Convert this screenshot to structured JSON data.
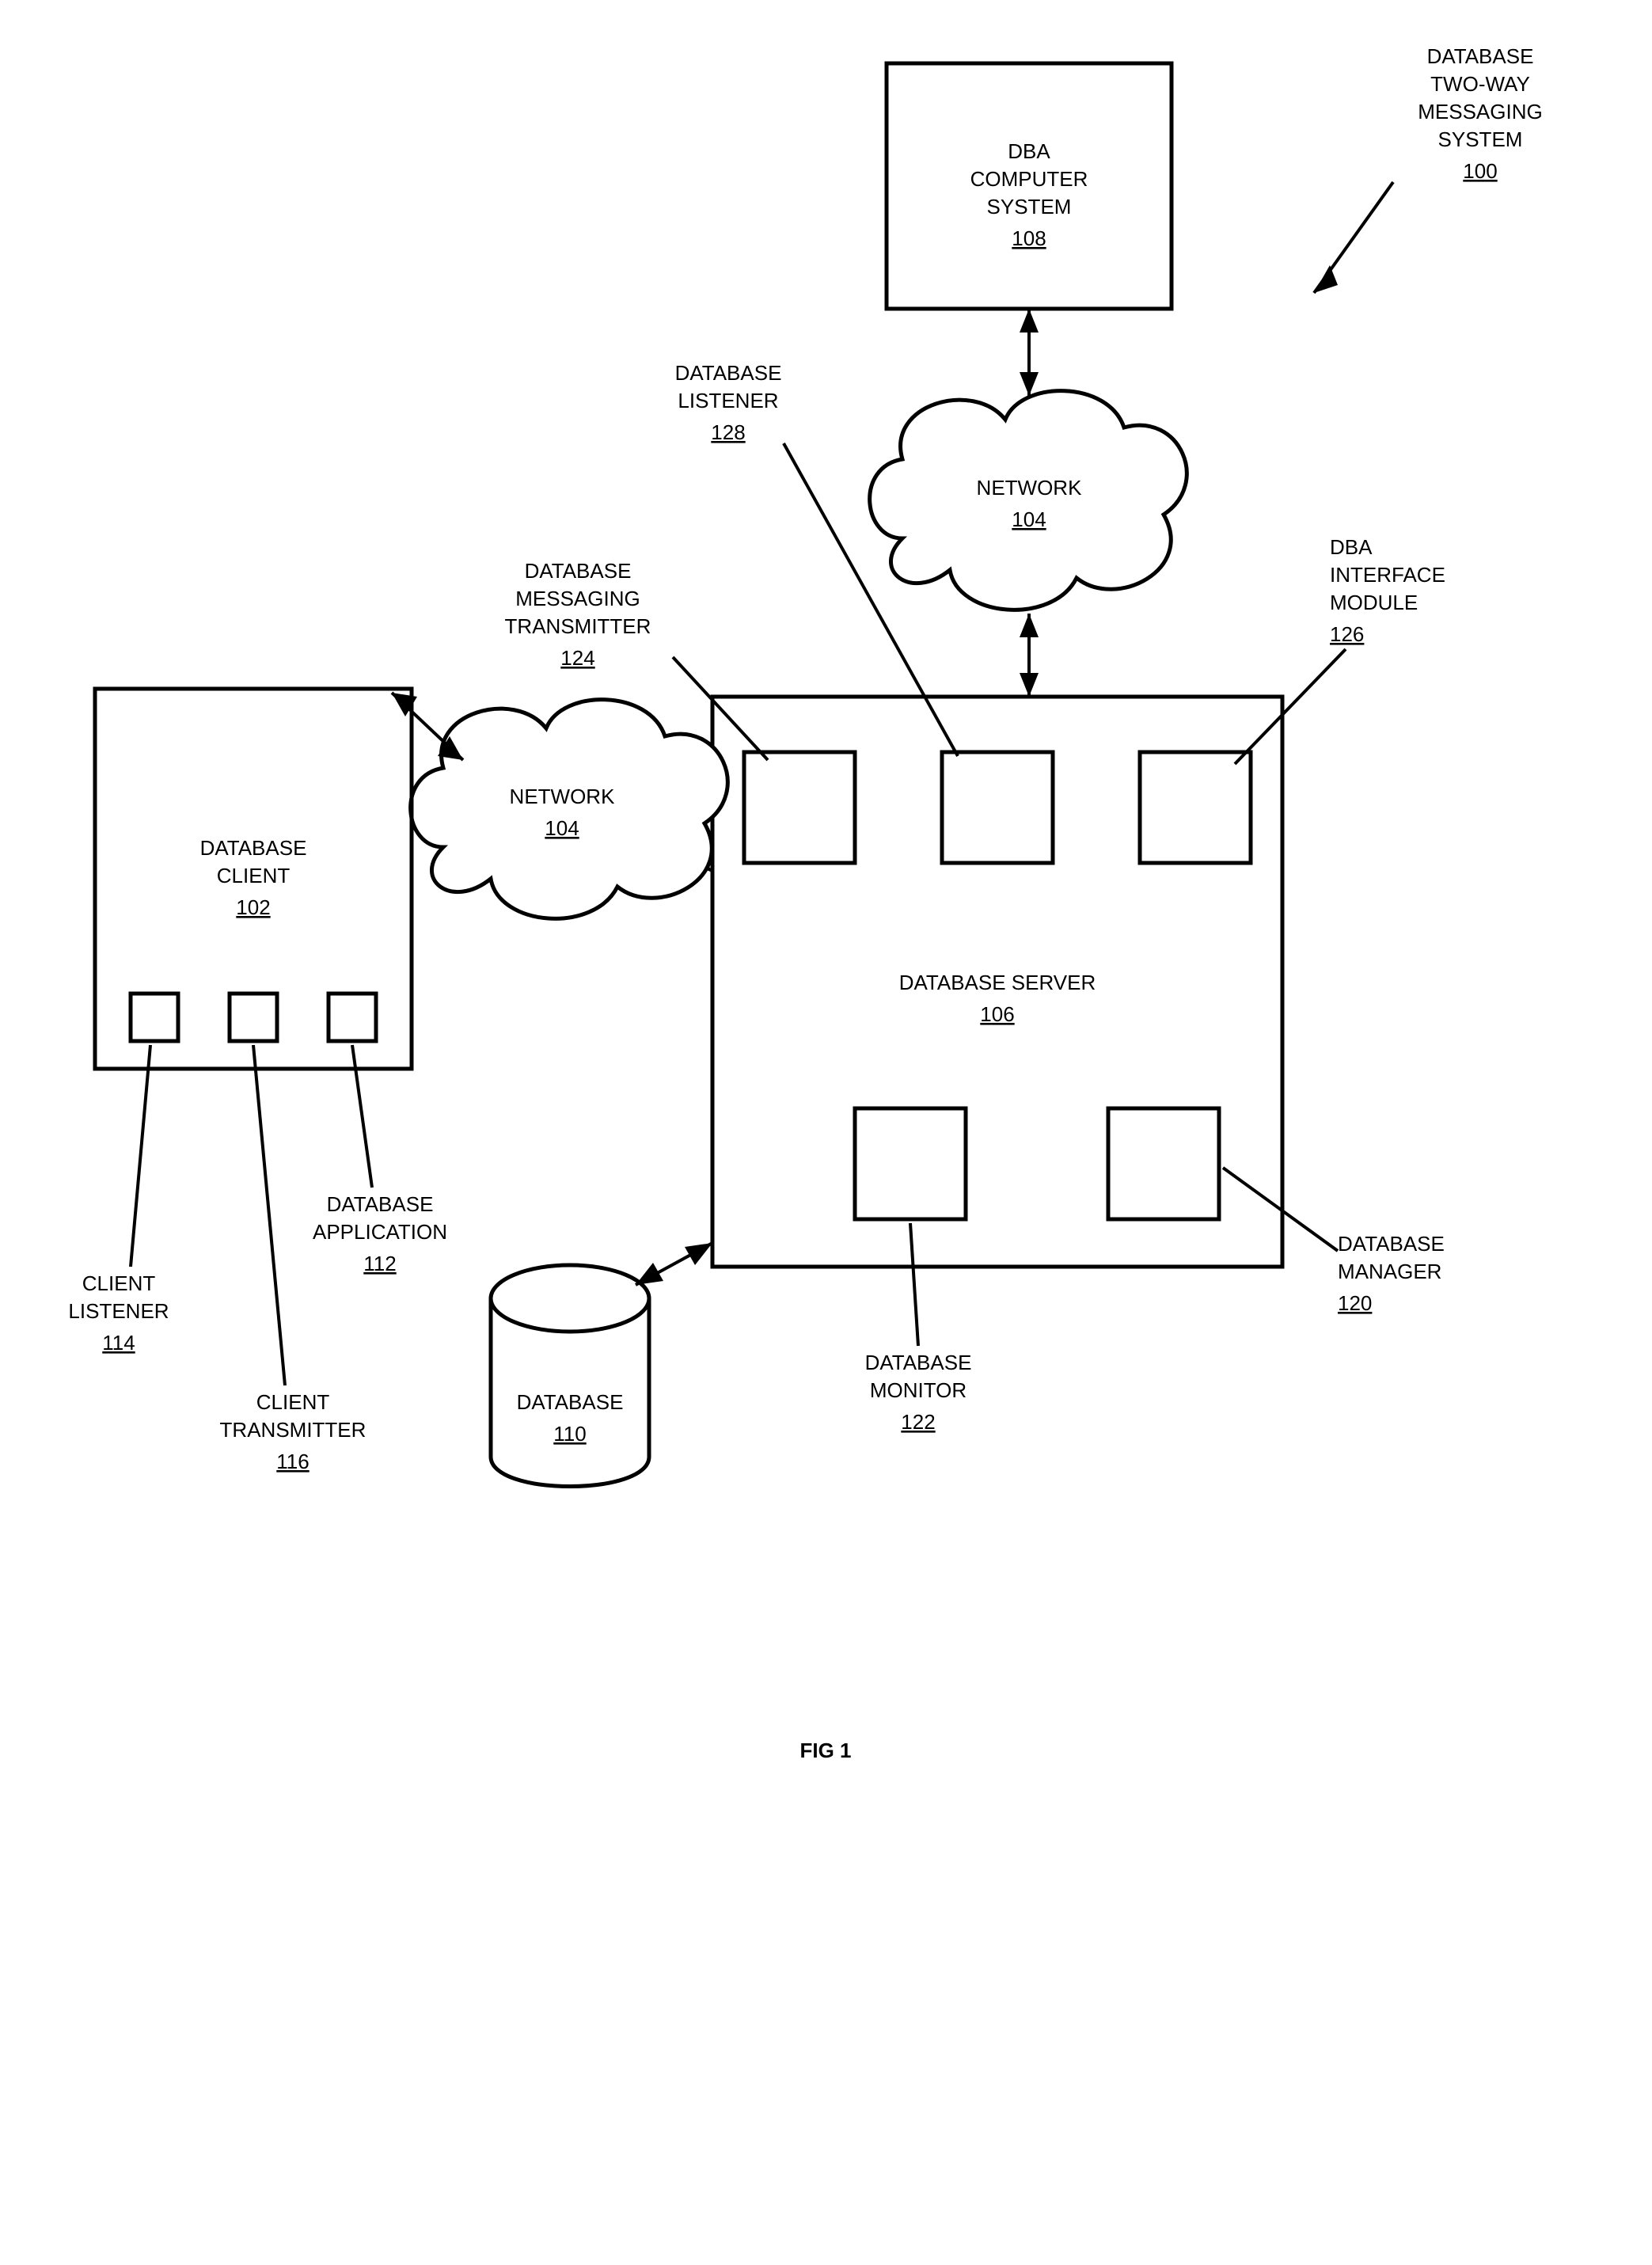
{
  "title": {
    "l1": "DATABASE",
    "l2": "TWO-WAY",
    "l3": "MESSAGING",
    "l4": "SYSTEM",
    "num": "100"
  },
  "dba_comp": {
    "l1": "DBA",
    "l2": "COMPUTER",
    "l3": "SYSTEM",
    "num": "108"
  },
  "db_client": {
    "l1": "DATABASE",
    "l2": "CLIENT",
    "num": "102"
  },
  "db_server": {
    "l1": "DATABASE SERVER",
    "num": "106"
  },
  "network": {
    "l1": "NETWORK",
    "num": "104"
  },
  "database": {
    "l1": "DATABASE",
    "num": "110"
  },
  "client_listener": {
    "l1": "CLIENT",
    "l2": "LISTENER",
    "num": "114"
  },
  "client_xmit": {
    "l1": "CLIENT",
    "l2": "TRANSMITTER",
    "num": "116"
  },
  "db_app": {
    "l1": "DATABASE",
    "l2": "APPLICATION",
    "num": "112"
  },
  "db_msg_xmit": {
    "l1": "DATABASE",
    "l2": "MESSAGING",
    "l3": "TRANSMITTER",
    "num": "124"
  },
  "db_listener": {
    "l1": "DATABASE",
    "l2": "LISTENER",
    "num": "128"
  },
  "dba_if": {
    "l1": "DBA",
    "l2": "INTERFACE",
    "l3": "MODULE",
    "num": "126"
  },
  "db_monitor": {
    "l1": "DATABASE",
    "l2": "MONITOR",
    "num": "122"
  },
  "db_manager": {
    "l1": "DATABASE",
    "l2": "MANAGER",
    "num": "120"
  },
  "fig": "FIG 1"
}
